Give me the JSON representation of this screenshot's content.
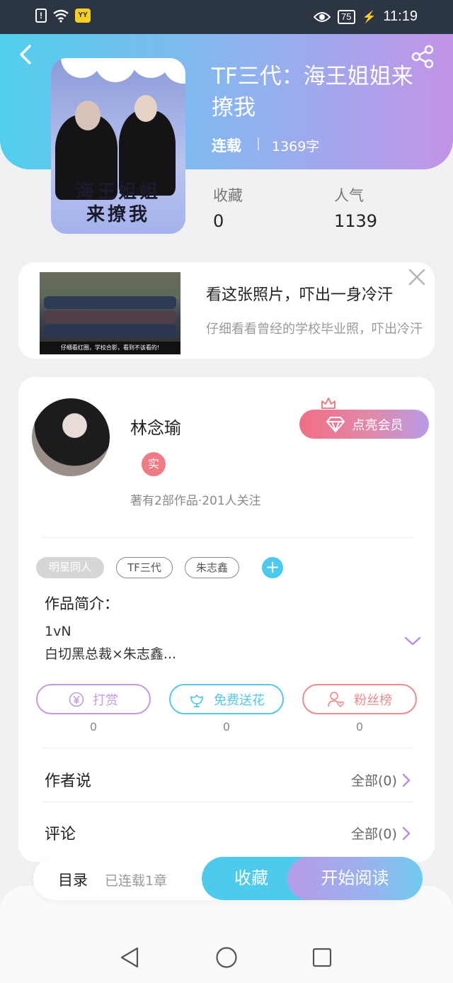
{
  "status_bar": {
    "time": "11:19",
    "battery": "75",
    "app_badge": "YY"
  },
  "book": {
    "title": "TF三代：海王姐姐来撩我",
    "status": "连载",
    "word_count": "1369字",
    "cover_text_line1": "海王姐姐",
    "cover_text_line2": "来撩我",
    "stats": {
      "collect_label": "收藏",
      "collect_value": "0",
      "popularity_label": "人气",
      "popularity_value": "1139"
    }
  },
  "ad": {
    "title": "看这张照片，吓出一身冷汗",
    "description": "仔细看看曾经的学校毕业照，吓出冷汗",
    "image_caption": "仔细看红圈，学校合影，看到不该看的!"
  },
  "author": {
    "name": "林念瑜",
    "badge": "实",
    "meta": "著有2部作品·201人关注",
    "vip_button": "点亮会员"
  },
  "tags": [
    "明星同人",
    "TF三代",
    "朱志鑫"
  ],
  "tag_add": "+",
  "intro": {
    "title": "作品简介：",
    "line1": "1vN",
    "line2": "白切黑总裁×朱志鑫..."
  },
  "actions": [
    {
      "label": "打赏",
      "count": "0",
      "color": "#c39be6"
    },
    {
      "label": "免费送花",
      "count": "0",
      "color": "#52c8ec"
    },
    {
      "label": "粉丝榜",
      "count": "0",
      "color": "#ef8a8e"
    }
  ],
  "sections": {
    "author_says": {
      "title": "作者说",
      "link": "全部(0)"
    },
    "comments": {
      "title": "评论",
      "link": "全部(0)"
    }
  },
  "bottom_bar": {
    "catalog": "目录",
    "chapters": "已连载1章",
    "collect": "收藏",
    "read": "开始阅读"
  }
}
